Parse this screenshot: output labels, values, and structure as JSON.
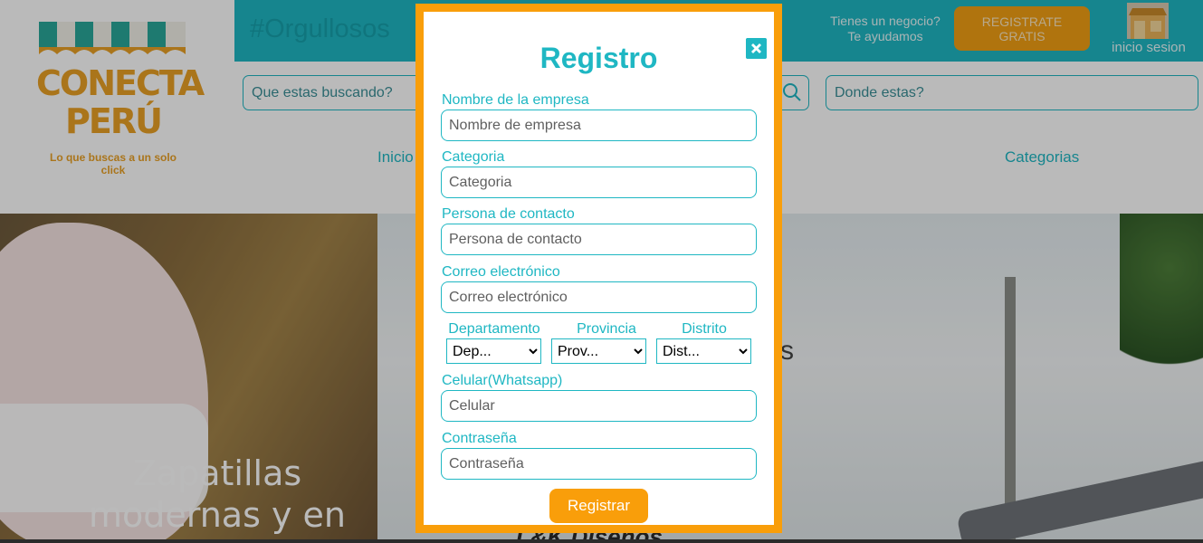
{
  "brand": {
    "name_line1": "CONECTA",
    "name_line2": "PERÚ",
    "tagline": "Lo que buscas a un solo click"
  },
  "topbar": {
    "hashtag": "#Orgullosos",
    "help_line1": "Tienes un negocio?",
    "help_line2": "Te ayudamos",
    "register_line1": "REGISTRATE",
    "register_line2": "GRATIS",
    "login_label": "inicio sesion"
  },
  "search": {
    "placeholder": "Que estas buscando?",
    "location_placeholder": "Donde estas?"
  },
  "nav": {
    "items": [
      {
        "label": "Inicio"
      },
      {
        "label": "Categorias"
      }
    ]
  },
  "hero": {
    "left_text_line1": "Zapatillas",
    "left_text_line2": "modernas y en",
    "right_fragment": "s",
    "right_bottom_text": "L&K Disenos"
  },
  "modal": {
    "title": "Registro",
    "fields": [
      {
        "label": "Nombre de la empresa",
        "placeholder": "Nombre de empresa"
      },
      {
        "label": "Categoria",
        "placeholder": "Categoria"
      },
      {
        "label": "Persona de contacto",
        "placeholder": "Persona de contacto"
      },
      {
        "label": "Correo electrónico",
        "placeholder": "Correo electrónico"
      },
      {
        "label": "Celular(Whatsapp)",
        "placeholder": "Celular"
      },
      {
        "label": "Contraseña",
        "placeholder": "Contraseña"
      }
    ],
    "selects": [
      {
        "label": "Departamento",
        "value": "Dep..."
      },
      {
        "label": "Provincia",
        "value": "Prov..."
      },
      {
        "label": "Distrito",
        "value": "Dist..."
      }
    ],
    "submit_label": "Registrar"
  },
  "colors": {
    "accent": "#1fb7c3",
    "orange": "#f99e0a",
    "brand_gold": "#e9a126"
  }
}
